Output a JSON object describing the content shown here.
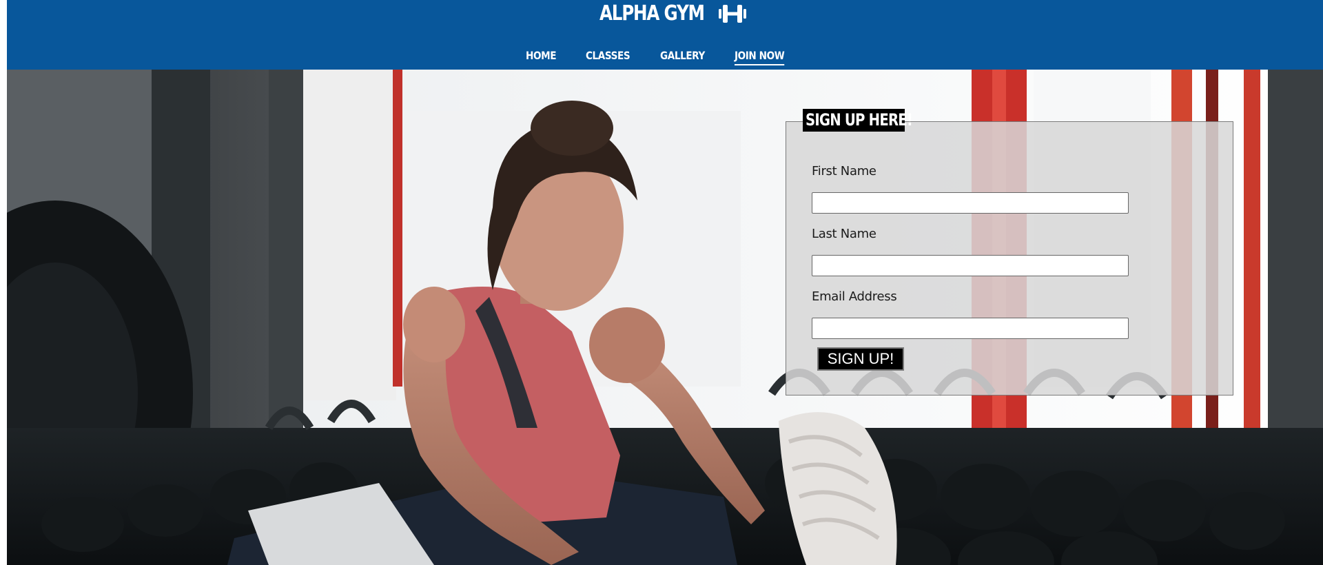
{
  "brand": {
    "name": "ALPHA GYM",
    "icon": "dumbbell-icon"
  },
  "nav": {
    "items": [
      {
        "label": "HOME"
      },
      {
        "label": "CLASSES"
      },
      {
        "label": "GALLERY"
      },
      {
        "label": "JOIN NOW",
        "active": true
      }
    ]
  },
  "hero": {
    "image": "woman-stretching-in-gym-photo"
  },
  "signup": {
    "title": "SIGN UP HERE!",
    "fields": [
      {
        "label": "First Name",
        "value": ""
      },
      {
        "label": "Last Name",
        "value": ""
      },
      {
        "label": "Email Address",
        "value": ""
      }
    ],
    "submit_label": "SIGN UP!"
  },
  "colors": {
    "header_bg": "#08579b",
    "form_bg": "#d7d7d7",
    "button_bg": "#000000"
  }
}
